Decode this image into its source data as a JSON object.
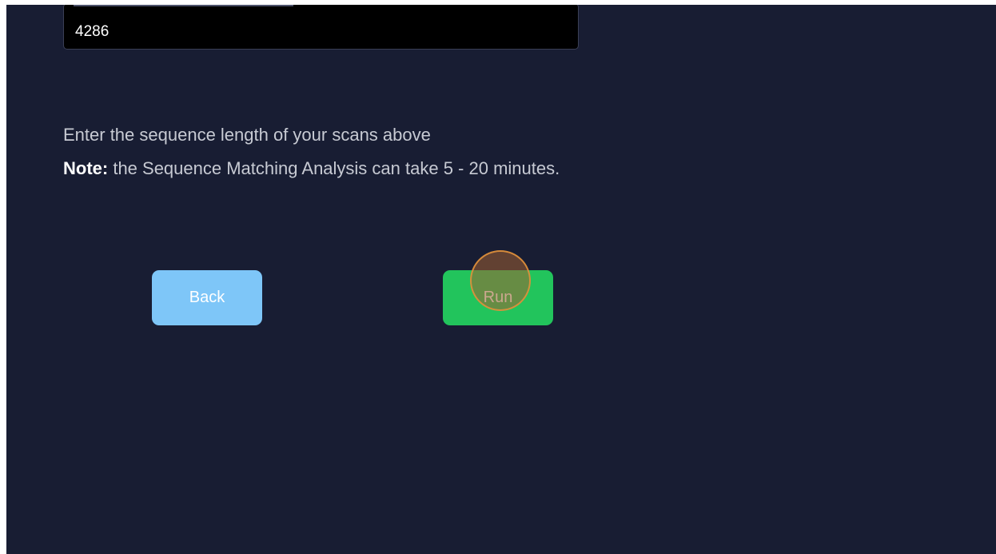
{
  "sequence_input": {
    "value": "4286"
  },
  "instructions": {
    "line1": "Enter the sequence length of your scans above",
    "note_label": "Note:",
    "note_text": " the Sequence Matching Analysis can take 5 - 20 minutes."
  },
  "buttons": {
    "back_label": "Back",
    "run_label": "Run"
  },
  "colors": {
    "background": "#181d33",
    "back_button": "#7ec6f8",
    "run_button": "#22c45c",
    "click_marker": "#e1913c"
  }
}
